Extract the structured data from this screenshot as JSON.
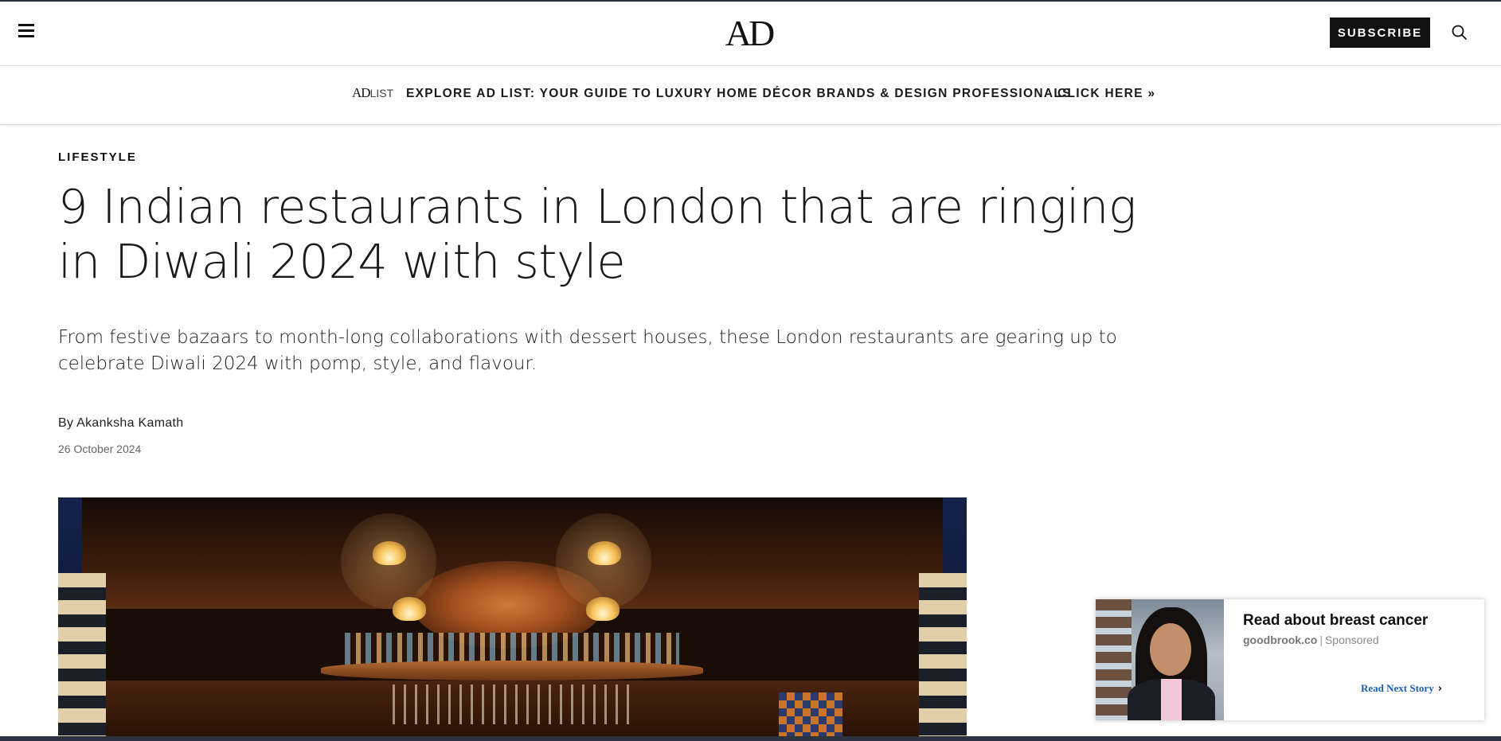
{
  "header": {
    "logo": "AD",
    "subscribe_label": "SUBSCRIBE"
  },
  "promo": {
    "logo_main": "AD",
    "logo_sub": "LIST",
    "text": "EXPLORE AD LIST: YOUR GUIDE TO LUXURY HOME DÉCOR BRANDS & DESIGN PROFESSIONALS",
    "link": "CLICK HERE »"
  },
  "article": {
    "rubric": "LIFESTYLE",
    "headline": "9 Indian restaurants in London that are ringing in Diwali 2024 with style",
    "dek": "From festive bazaars to month-long collaborations with dessert houses, these London restaurants are gearing up to celebrate Diwali 2024 with pomp, style, and flavour.",
    "byline_prefix": "By ",
    "author": "Akanksha Kamath",
    "date": "26 October 2024"
  },
  "ad": {
    "title": "Read about breast cancer",
    "domain": "goodbrook.co",
    "separator": "|",
    "sponsored": "Sponsored",
    "next_story": "Read Next Story",
    "next_chevron": "›"
  },
  "icons": {
    "menu": "hamburger-menu-icon",
    "search": "search-icon"
  },
  "colors": {
    "text": "#111111",
    "subscribe_bg": "#111111",
    "ad_link": "#1a5fb4",
    "frame_strip": "#2c3340"
  }
}
